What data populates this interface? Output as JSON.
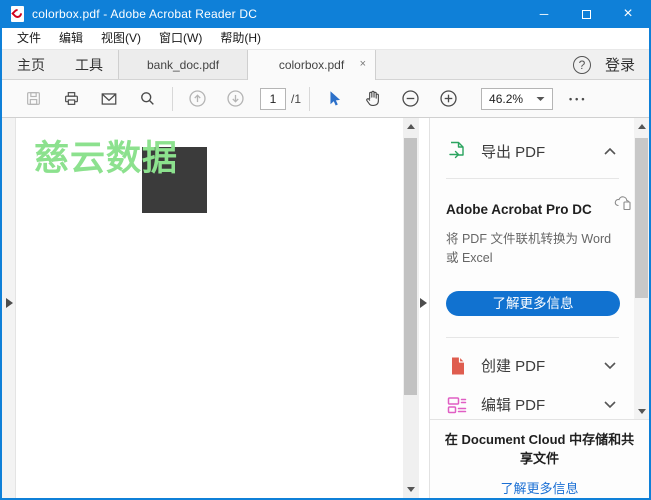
{
  "window": {
    "title": "colorbox.pdf - Adobe Acrobat Reader DC",
    "minimize_glyph": "─",
    "close_glyph": "×"
  },
  "menu": {
    "items": [
      {
        "label": "文件"
      },
      {
        "label": "编辑"
      },
      {
        "label": "视图(V)"
      },
      {
        "label": "窗口(W)"
      },
      {
        "label": "帮助(H)"
      }
    ]
  },
  "tabs": {
    "home": "主页",
    "tools": "工具",
    "documents": [
      {
        "label": "bank_doc.pdf",
        "active": false
      },
      {
        "label": "colorbox.pdf",
        "active": true
      }
    ],
    "close_glyph": "×",
    "help_glyph": "?",
    "sign_in": "登录"
  },
  "toolbar": {
    "page_current": "1",
    "page_total": "/1",
    "zoom_value": "46.2%",
    "more_glyph": "•••"
  },
  "document": {
    "watermark": "慈云数据"
  },
  "sidebar": {
    "export": {
      "title": "导出 PDF"
    },
    "promo": {
      "heading": "Adobe Acrobat Pro DC",
      "description": "将 PDF 文件联机转换为 Word 或 Excel",
      "button": "了解更多信息"
    },
    "create": {
      "title": "创建 PDF"
    },
    "edit": {
      "title": "编辑 PDF"
    },
    "cloud": {
      "text": "在 Document Cloud 中存储和共享文件",
      "link": "了解更多信息"
    }
  },
  "icons": {
    "titlebar": "acrobat-logo-icon",
    "toolbar": [
      "save-icon",
      "print-icon",
      "email-icon",
      "search-icon",
      "page-up-icon",
      "page-down-icon",
      "select-cursor-icon",
      "hand-tool-icon",
      "zoom-out-icon",
      "zoom-in-icon",
      "caret-down-icon",
      "more-dots-icon"
    ],
    "sidebar": [
      "export-pdf-icon",
      "cloud-copy-icon",
      "create-pdf-icon",
      "edit-pdf-icon",
      "chevron-up-icon",
      "chevron-down-icon"
    ]
  },
  "colors": {
    "titlebar": "#0f80d8",
    "accent_button": "#1172d0",
    "link": "#1a6fd4",
    "export_icon": "#2aa45f",
    "create_icon": "#dc4b3c",
    "edit_icon": "#e05ec4",
    "watermark": "#8ce18e",
    "square": "#3b3b3b"
  }
}
